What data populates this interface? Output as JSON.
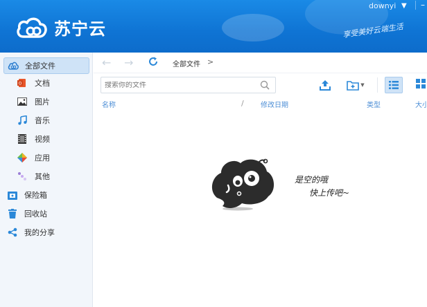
{
  "app": {
    "name": "苏宁云",
    "slogan": "享受美好云端生活",
    "username": "downyi",
    "brand_color": "#1580dc"
  },
  "window_controls": {
    "menu_icon": "dropdown-triangle-icon",
    "minimize_icon": "minimize-icon"
  },
  "sidebar": {
    "items": [
      {
        "label": "全部文件",
        "icon": "cloud-icon",
        "active": true
      },
      {
        "label": "文档",
        "icon": "document-icon"
      },
      {
        "label": "图片",
        "icon": "image-icon"
      },
      {
        "label": "音乐",
        "icon": "music-icon"
      },
      {
        "label": "视频",
        "icon": "video-icon"
      },
      {
        "label": "应用",
        "icon": "app-icon"
      },
      {
        "label": "其他",
        "icon": "other-icon"
      },
      {
        "label": "保险箱",
        "icon": "safe-icon"
      },
      {
        "label": "回收站",
        "icon": "trash-icon"
      },
      {
        "label": "我的分享",
        "icon": "share-icon"
      }
    ]
  },
  "nav": {
    "breadcrumb": "全部文件",
    "breadcrumb_arrow": ">"
  },
  "search": {
    "placeholder": "搜索你的文件"
  },
  "columns": {
    "name": "名称",
    "sort_separator": "/",
    "modified": "修改日期",
    "type": "类型",
    "size": "大小"
  },
  "empty_state": {
    "line1": "是空的哦",
    "line2": "快上传吧~"
  }
}
